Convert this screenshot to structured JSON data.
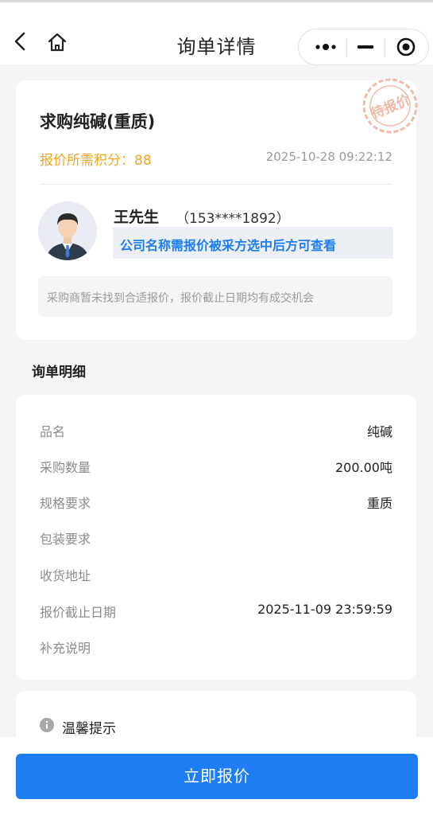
{
  "navbar": {
    "title": "询单详情",
    "back_icon": "chevron-left-icon",
    "home_icon": "home-icon",
    "capsule": {
      "more_icon": "more-dots-icon",
      "minimize_icon": "minimize-icon",
      "close_icon": "target-circle-icon"
    }
  },
  "request": {
    "title": "求购纯碱(重质)",
    "points_label": "报价所需积分：",
    "points_value": "88",
    "published_at": "2025-10-28 09:22:12",
    "stamp_text": "待报价",
    "stamp_color": "#f2b9a5"
  },
  "contact": {
    "name": "王先生",
    "phone": "（153****1892）",
    "company_hint": "公司名称需报价被采方选中后方可查看",
    "notice": "采购商暂未找到合适报价，报价截止日期均有成交机会"
  },
  "detail": {
    "section_title": "询单明细",
    "rows": [
      {
        "label": "品名",
        "value": "纯碱"
      },
      {
        "label": "采购数量",
        "value": "200.00吨"
      },
      {
        "label": "规格要求",
        "value": "重质"
      },
      {
        "label": "包装要求",
        "value": ""
      },
      {
        "label": "收货地址",
        "value": ""
      },
      {
        "label": "报价截止日期",
        "value": "2025-11-09 23:59:59"
      },
      {
        "label": "补充说明",
        "value": ""
      }
    ]
  },
  "tip": {
    "icon": "info-icon",
    "title": "温馨提示"
  },
  "action": {
    "quote_label": "立即报价"
  },
  "colors": {
    "accent": "#1e7df3",
    "points": "#f5a623",
    "muted": "#9a9a9a"
  }
}
